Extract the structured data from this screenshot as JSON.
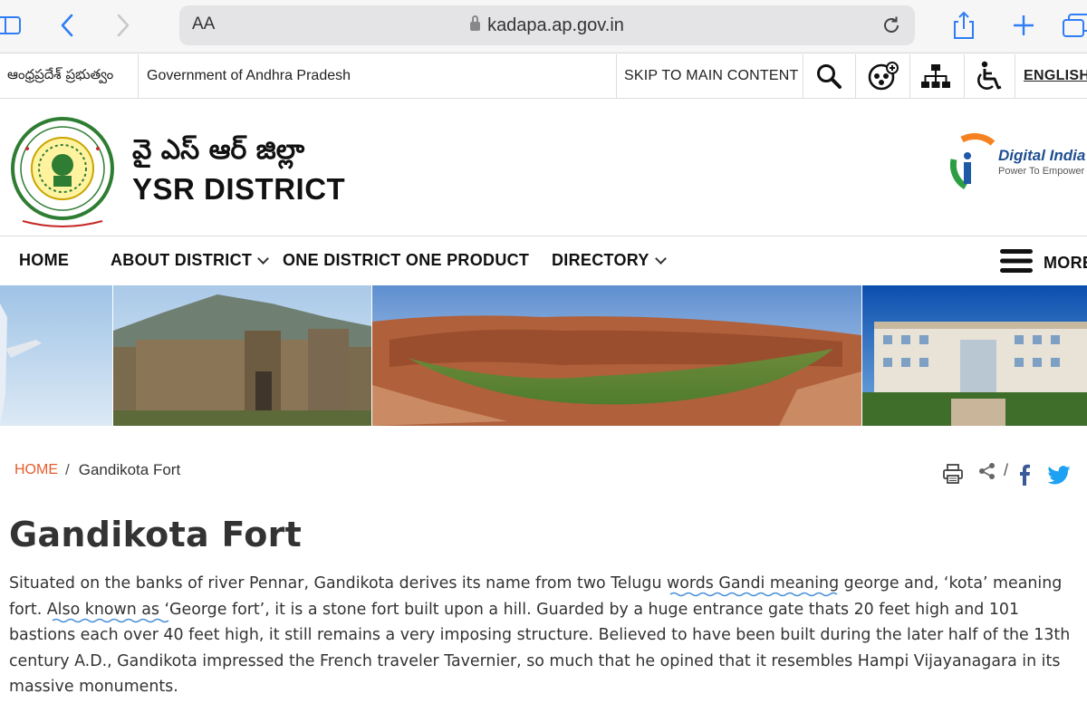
{
  "browser": {
    "text_size_label": "AA",
    "url": "kadapa.ap.gov.in"
  },
  "topbar": {
    "telugu_govt": "ఆంధ్రప్రదేశ్ ప్రభుత్వం",
    "govt_name": "Government of Andhra Pradesh",
    "skip_link": "SKIP TO MAIN CONTENT",
    "language": "ENGLISH"
  },
  "header": {
    "title_telugu": "వై ఎస్ ఆర్ జిల్లా",
    "title_english": "YSR DISTRICT",
    "digital_india_title": "Digital India",
    "digital_india_tagline": "Power To Empower"
  },
  "nav": {
    "home": "HOME",
    "about": "ABOUT DISTRICT",
    "odop": "ONE DISTRICT ONE PRODUCT",
    "directory": "DIRECTORY",
    "more": "MORE"
  },
  "breadcrumb": {
    "home": "HOME",
    "separator": "/",
    "current": "Gandikota Fort"
  },
  "share": {
    "separator": "/"
  },
  "page": {
    "title": "Gandikota Fort",
    "paragraph1": "Situated on the banks of river Pennar, Gandikota derives its name from two Telugu words Gandi meaning george and, ‘kota’ meaning fort.  Also known as ‘George fort’,  it is a stone fort built upon a hill.  Guarded by a huge entrance gate thats 20 feet high and 101 bastions each over 40 feet high, it still remains a very imposing structure. Believed to have been built during the later half of the 13th century A.D.,  Gandikota impressed the French traveler Tavernier, so much that he opined that it resembles Hampi Vijayanagara in its massive monuments."
  },
  "colors": {
    "accent": "#e65c2e",
    "facebook": "#3b5998",
    "twitter": "#1da1f2",
    "safari_blue": "#2f7df6"
  }
}
